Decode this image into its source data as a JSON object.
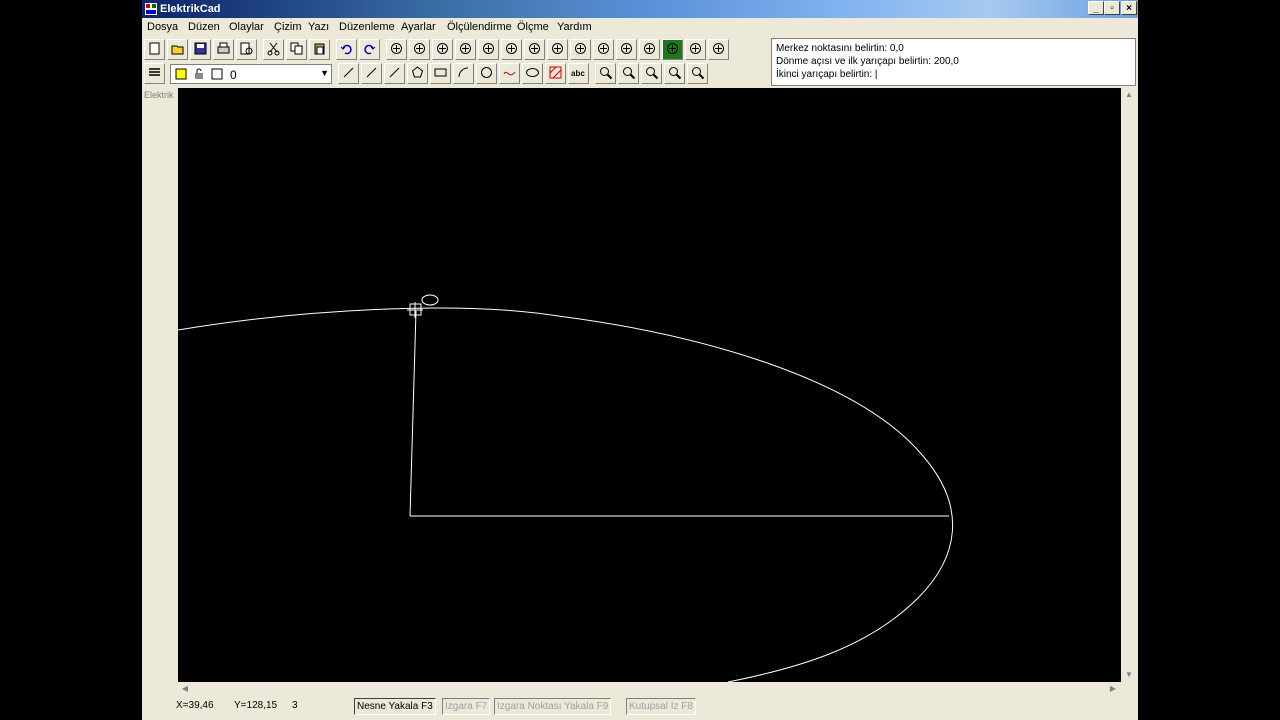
{
  "window": {
    "title": "ElektrikCad",
    "controls": [
      "_",
      "▫",
      "×"
    ]
  },
  "menu": [
    "Dosya",
    "Düzen",
    "Olaylar",
    "Çizim",
    "Yazı",
    "Düzenleme",
    "Ayarlar",
    "Ölçülendirme",
    "Ölçme",
    "Yardım"
  ],
  "toolbar1": [
    "new-icon",
    "open-icon",
    "save-icon",
    "print-icon",
    "print-preview-icon",
    "cut-icon",
    "copy-icon",
    "paste-icon",
    "undo-icon",
    "redo-icon",
    "offset-icon",
    "mirror-icon",
    "array-icon",
    "move-icon",
    "rotate-icon",
    "scale-icon",
    "copy-object-icon",
    "explode-icon",
    "stretch-icon",
    "trim-icon",
    "extend-icon",
    "fillet-icon",
    "osnap-icon",
    "pan-icon",
    "measure-icon"
  ],
  "toolbar2": [
    "line-icon",
    "polyline-icon",
    "multiline-icon",
    "polygon-icon",
    "rectangle-icon",
    "arc-icon",
    "circle-icon",
    "spline-icon",
    "ellipse-icon",
    "hatch-icon",
    "text-icon",
    "zoom-realtime-icon",
    "zoom-window-icon",
    "zoom-previous-icon",
    "zoom-extents-icon",
    "zoom-all-icon"
  ],
  "layer": {
    "value": "0"
  },
  "panel_label": "Elektrik",
  "command": {
    "line1": "Merkez noktasını belirtin:  0,0",
    "line2": "Dönme açısı ve ilk yarıçapı belirtin:  200,0",
    "line3": "İkinci yarıçapı belirtin:  |"
  },
  "status": {
    "x": "X=39,46",
    "y": "Y=128,15",
    "n": "3",
    "buttons": [
      {
        "label": "Nesne Yakala F3",
        "on": true
      },
      {
        "label": "Izgara F7",
        "on": false
      },
      {
        "label": "Izgara Noktası Yakala  F9",
        "on": false
      },
      {
        "label": "Kutupsal Iz  F8",
        "on": false
      }
    ]
  },
  "colors": {
    "titlebar_start": "#0a246a",
    "canvas": "#000000",
    "entity": "#ffffff",
    "chrome": "#ece9d8"
  }
}
